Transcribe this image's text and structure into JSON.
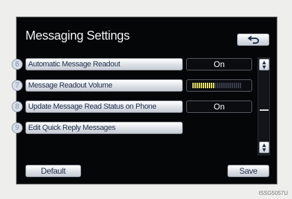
{
  "screen": {
    "title": "Messaging Settings",
    "back_icon": "back-arrow-icon"
  },
  "rows": [
    {
      "number": "6",
      "label": "Automatic Message Readout",
      "value": "On"
    },
    {
      "number": "7",
      "label": "Message Readout Volume",
      "volume_level": 0.45
    },
    {
      "number": "8",
      "label": "Update Message Read Status on Phone",
      "value": "On"
    },
    {
      "number": "9",
      "label": "Edit Quick Reply Messages"
    }
  ],
  "footer": {
    "default_label": "Default",
    "save_label": "Save"
  },
  "scroll": {
    "up_icon": "scroll-up-icon",
    "down_icon": "scroll-down-icon"
  },
  "image_code": "ISSG5057U",
  "colors": {
    "volume_on": "#e8e36a",
    "volume_off": "#3a3e4e"
  }
}
